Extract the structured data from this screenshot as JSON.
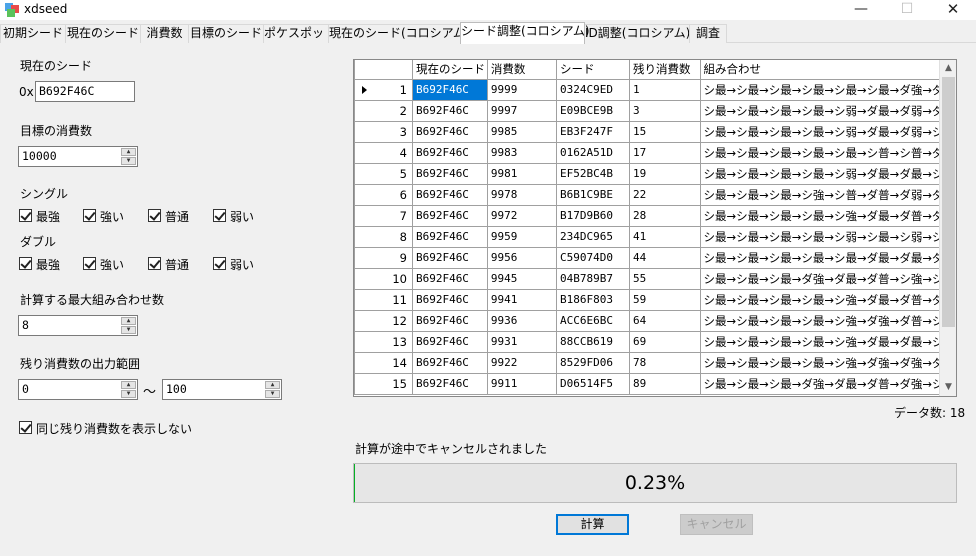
{
  "window": {
    "title": "xdseed",
    "minimize_glyph": "—",
    "maximize_glyph": "☐",
    "close_glyph": "✕"
  },
  "tabs": [
    {
      "label": "初期シード"
    },
    {
      "label": "現在のシード"
    },
    {
      "label": "消費数"
    },
    {
      "label": "目標のシード"
    },
    {
      "label": "ポケスポット"
    },
    {
      "label": "現在のシード(コロシアム)"
    },
    {
      "label": "シード調整(コロシアム)"
    },
    {
      "label": "ID調整(コロシアム)"
    },
    {
      "label": "調査"
    }
  ],
  "active_tab": "シード調整(コロシアム)",
  "form": {
    "current_seed_label": "現在のシード",
    "hex_prefix": "0x",
    "current_seed_value": "B692F46C",
    "target_consumption_label": "目標の消費数",
    "target_consumption_value": "10000",
    "single_label": "シングル",
    "double_label": "ダブル",
    "single_options": [
      {
        "label": "最強",
        "checked": true
      },
      {
        "label": "強い",
        "checked": true
      },
      {
        "label": "普通",
        "checked": true
      },
      {
        "label": "弱い",
        "checked": true
      }
    ],
    "double_options": [
      {
        "label": "最強",
        "checked": true
      },
      {
        "label": "強い",
        "checked": true
      },
      {
        "label": "普通",
        "checked": true
      },
      {
        "label": "弱い",
        "checked": true
      }
    ],
    "max_combos_label": "計算する最大組み合わせ数",
    "max_combos_value": "8",
    "remaining_range_label": "残り消費数の出力範囲",
    "range_min": "0",
    "range_separator": "〜",
    "range_max": "100",
    "hide_duplicates_label": "同じ残り消費数を表示しない",
    "hide_duplicates_checked": true
  },
  "grid": {
    "columns": [
      "現在のシード",
      "消費数",
      "シード",
      "残り消費数",
      "組み合わせ"
    ],
    "rows": [
      {
        "num": "1",
        "cur": "B692F46C",
        "count": "9999",
        "seed": "0324C9ED",
        "remain": "1",
        "combo": "シ最→シ最→シ最→シ最→シ最→シ最→ダ強→ダ弱"
      },
      {
        "num": "2",
        "cur": "B692F46C",
        "count": "9997",
        "seed": "E09BCE9B",
        "remain": "3",
        "combo": "シ最→シ最→シ最→シ最→シ弱→ダ最→ダ弱→ダ最"
      },
      {
        "num": "3",
        "cur": "B692F46C",
        "count": "9985",
        "seed": "EB3F247F",
        "remain": "15",
        "combo": "シ最→シ最→シ最→シ最→シ弱→ダ最→ダ弱→シ強"
      },
      {
        "num": "4",
        "cur": "B692F46C",
        "count": "9983",
        "seed": "0162A51D",
        "remain": "17",
        "combo": "シ最→シ最→シ最→シ最→シ最→シ普→シ普→ダ強"
      },
      {
        "num": "5",
        "cur": "B692F46C",
        "count": "9981",
        "seed": "EF52BC4B",
        "remain": "19",
        "combo": "シ最→シ最→シ最→シ最→シ弱→ダ最→ダ最→シ強"
      },
      {
        "num": "6",
        "cur": "B692F46C",
        "count": "9978",
        "seed": "B6B1C9BE",
        "remain": "22",
        "combo": "シ最→シ最→シ最→シ強→シ普→ダ普→ダ弱→ダ最"
      },
      {
        "num": "7",
        "cur": "B692F46C",
        "count": "9972",
        "seed": "B17D9B60",
        "remain": "28",
        "combo": "シ最→シ最→シ最→シ最→シ強→ダ最→ダ普→ダ弱"
      },
      {
        "num": "8",
        "cur": "B692F46C",
        "count": "9959",
        "seed": "234DC965",
        "remain": "41",
        "combo": "シ最→シ最→シ最→シ最→シ弱→シ最→シ弱→シ弱"
      },
      {
        "num": "9",
        "cur": "B692F46C",
        "count": "9956",
        "seed": "C59074D0",
        "remain": "44",
        "combo": "シ最→シ最→シ最→シ最→シ最→ダ最→ダ最→ダ弱"
      },
      {
        "num": "10",
        "cur": "B692F46C",
        "count": "9945",
        "seed": "04B789B7",
        "remain": "55",
        "combo": "シ最→シ最→シ最→ダ強→ダ最→ダ普→シ強→シ普"
      },
      {
        "num": "11",
        "cur": "B692F46C",
        "count": "9941",
        "seed": "B186F803",
        "remain": "59",
        "combo": "シ最→シ最→シ最→シ最→シ強→ダ最→ダ普→ダ弱"
      },
      {
        "num": "12",
        "cur": "B692F46C",
        "count": "9936",
        "seed": "ACC6E6BC",
        "remain": "64",
        "combo": "シ最→シ最→シ最→シ最→シ強→ダ強→ダ普→シ弱"
      },
      {
        "num": "13",
        "cur": "B692F46C",
        "count": "9931",
        "seed": "88CCB619",
        "remain": "69",
        "combo": "シ最→シ最→シ最→シ最→シ強→ダ最→ダ最→シ強"
      },
      {
        "num": "14",
        "cur": "B692F46C",
        "count": "9922",
        "seed": "8529FD06",
        "remain": "78",
        "combo": "シ最→シ最→シ最→シ最→シ強→ダ強→ダ強→ダ普"
      },
      {
        "num": "15",
        "cur": "B692F46C",
        "count": "9911",
        "seed": "D06514F5",
        "remain": "89",
        "combo": "シ最→シ最→シ最→ダ強→ダ最→ダ普→ダ強→シ弱"
      }
    ],
    "selected_row": 1
  },
  "data_count_label": "データ数: 18",
  "status_text": "計算が途中でキャンセルされました",
  "progress": {
    "fraction": 0.0023,
    "label": "0.23%",
    "color": "#06b025"
  },
  "buttons": {
    "calculate": "計算",
    "cancel": "キャンセル"
  },
  "colors": {
    "selection": "#0078d7",
    "focus_border": "#0078d7"
  }
}
